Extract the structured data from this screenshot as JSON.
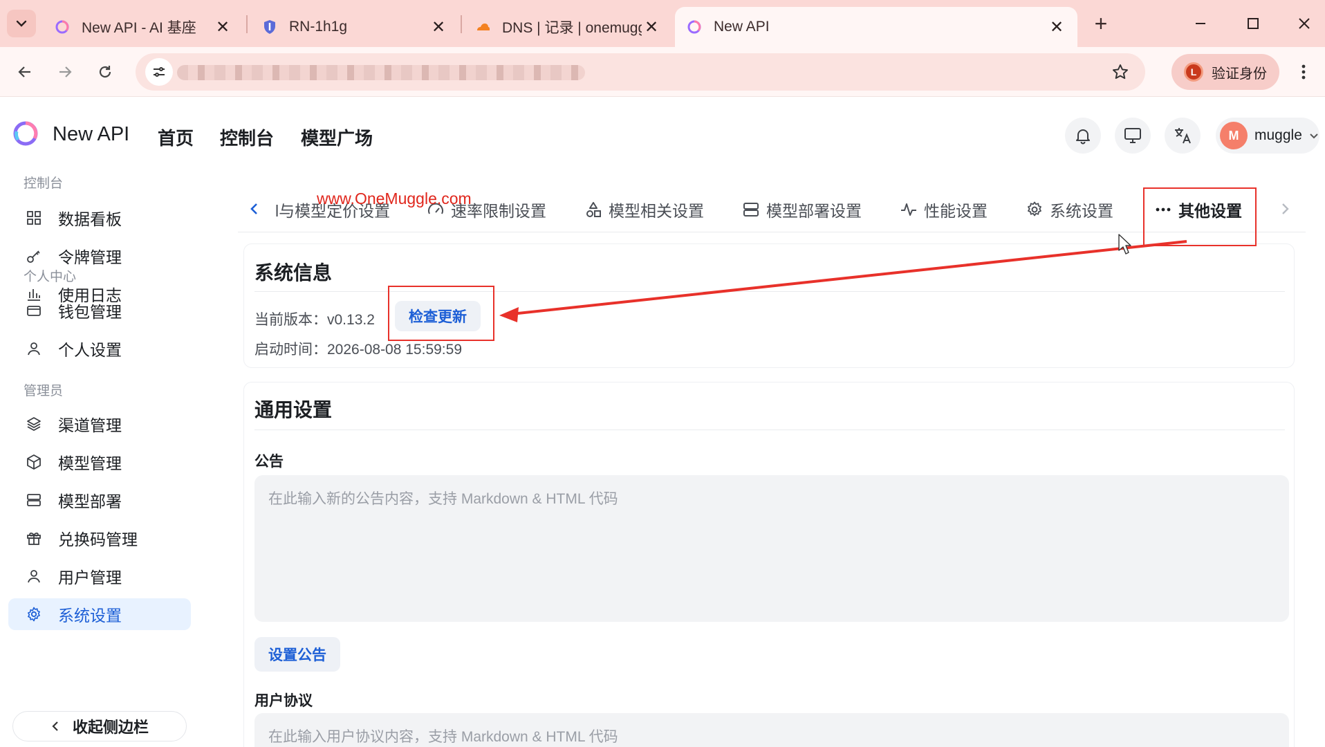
{
  "browser": {
    "tabs": [
      {
        "title": "New API - AI 基座",
        "icon": "newapi-favicon"
      },
      {
        "title": "RN-1h1g",
        "icon": "shield-favicon"
      },
      {
        "title": "DNS | 记录 | onemuggle.com",
        "icon": "cloudflare-favicon"
      },
      {
        "title": "New API",
        "icon": "newapi-favicon",
        "active": true
      }
    ],
    "profile_label": "验证身份",
    "profile_initial": "L"
  },
  "header": {
    "brand": "New API",
    "nav": [
      "首页",
      "控制台",
      "模型广场"
    ],
    "user_initial": "M",
    "user_name": "muggle"
  },
  "sidebar": {
    "groups": [
      {
        "label": "控制台",
        "items": [
          {
            "label": "数据看板",
            "icon": "dashboard-icon"
          },
          {
            "label": "令牌管理",
            "icon": "key-icon"
          },
          {
            "label": "使用日志",
            "icon": "bar-chart-icon"
          }
        ]
      },
      {
        "label": "个人中心",
        "items": [
          {
            "label": "钱包管理",
            "icon": "wallet-icon"
          },
          {
            "label": "个人设置",
            "icon": "user-icon"
          }
        ]
      },
      {
        "label": "管理员",
        "items": [
          {
            "label": "渠道管理",
            "icon": "layers-icon"
          },
          {
            "label": "模型管理",
            "icon": "cube-icon"
          },
          {
            "label": "模型部署",
            "icon": "server-icon"
          },
          {
            "label": "兑换码管理",
            "icon": "gift-icon"
          },
          {
            "label": "用户管理",
            "icon": "user-icon"
          },
          {
            "label": "系统设置",
            "icon": "gear-icon",
            "active": true
          }
        ]
      }
    ],
    "collapse_label": "收起侧边栏"
  },
  "settings_tabs": {
    "items": [
      {
        "label": "l与模型定价设置",
        "icon": ""
      },
      {
        "label": "速率限制设置",
        "icon": "gauge-icon"
      },
      {
        "label": "模型相关设置",
        "icon": "shapes-icon"
      },
      {
        "label": "模型部署设置",
        "icon": "server-icon"
      },
      {
        "label": "性能设置",
        "icon": "pulse-icon"
      },
      {
        "label": "系统设置",
        "icon": "gear-icon"
      },
      {
        "label": "其他设置",
        "icon": "more-icon",
        "active": true
      }
    ]
  },
  "watermark": "www.OneMuggle.com",
  "system_info": {
    "title": "系统信息",
    "version_label": "当前版本：",
    "version_value": "v0.13.2",
    "check_update": "检查更新",
    "start_label": "启动时间：",
    "start_value": "2026-08-08 15:59:59"
  },
  "general": {
    "title": "通用设置",
    "notice_label": "公告",
    "notice_placeholder": "在此输入新的公告内容，支持 Markdown & HTML 代码",
    "notice_button": "设置公告",
    "agreement_label": "用户协议",
    "agreement_placeholder": "在此输入用户协议内容，支持 Markdown & HTML 代码"
  },
  "colors": {
    "accent": "#1d5fd6",
    "annotation": "#e8312a",
    "tabstrip": "#fbd8d5"
  }
}
